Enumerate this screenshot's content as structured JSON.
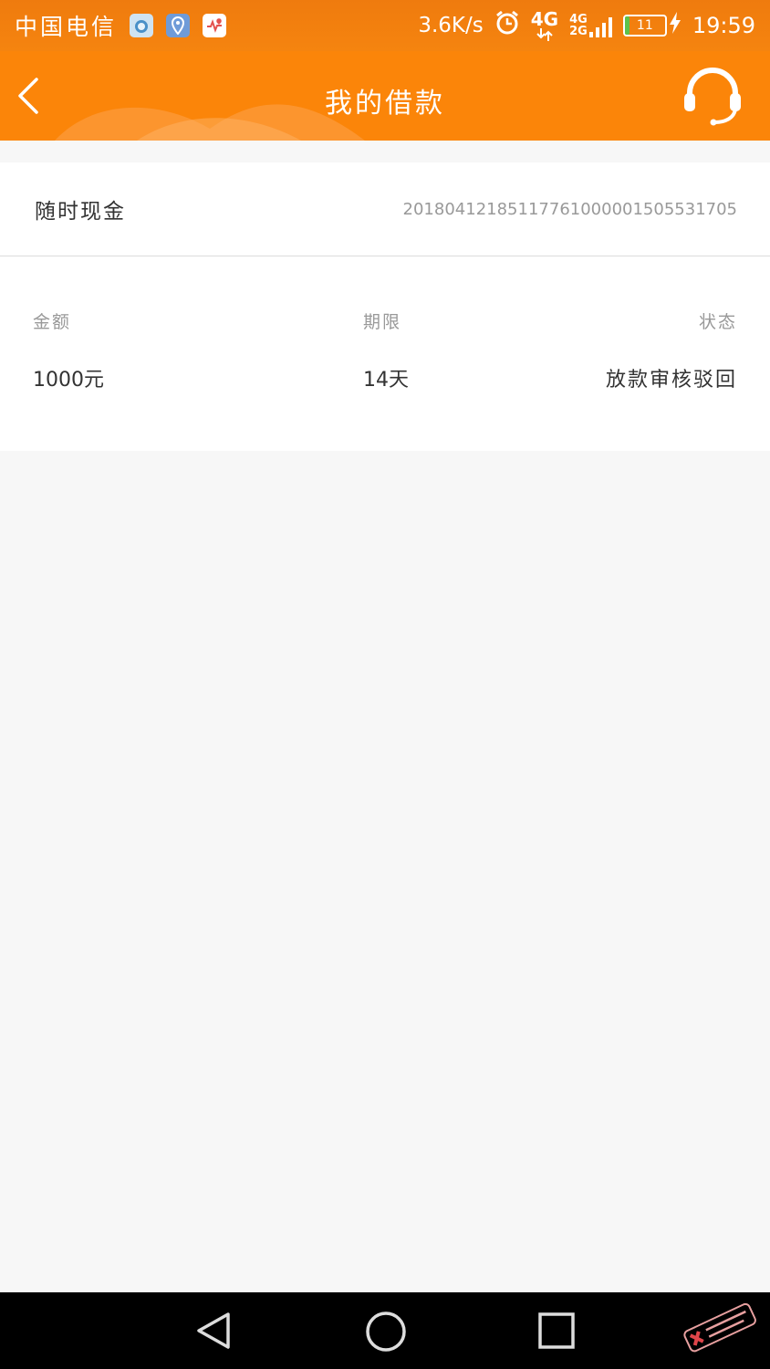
{
  "status_bar": {
    "carrier": "中国电信",
    "net_speed": "3.6K/s",
    "network_primary": "4G",
    "network_secondary_top": "4G",
    "network_secondary_bottom": "2G",
    "battery_level": "11",
    "battery_fraction": 0.11,
    "time": "19:59",
    "app_icons": [
      "weather-icon",
      "location-app-icon",
      "health-app-icon"
    ]
  },
  "header": {
    "title": "我的借款",
    "left_icon": "back-chevron-icon",
    "right_icon": "headset-icon",
    "background_color": "#fb8509"
  },
  "loan": {
    "product_name": "随时现金",
    "order_number": "20180412185117761000001505531705",
    "columns": [
      "金额",
      "期限",
      "状态"
    ],
    "row": {
      "amount": "1000元",
      "term": "14天",
      "status": "放款审核驳回"
    }
  },
  "nav_bar": {
    "icons": [
      "nav-back-icon",
      "nav-home-icon",
      "nav-recent-icon"
    ]
  }
}
